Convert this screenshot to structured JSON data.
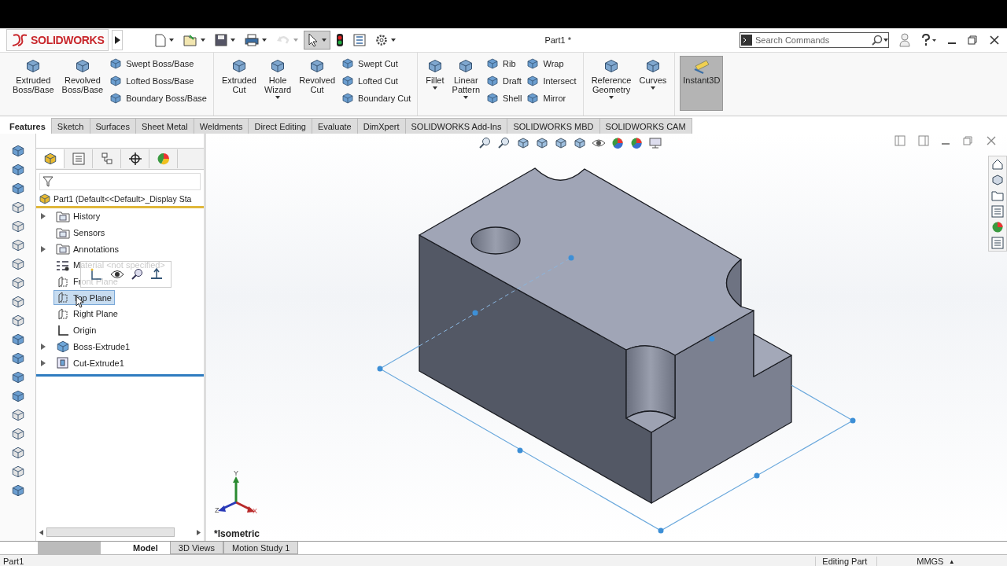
{
  "title_bar": {
    "logo": "SOLIDWORKS",
    "document_title": "Part1 *",
    "search": {
      "placeholder": "Search Commands"
    }
  },
  "quick_access": [
    {
      "kind": "new",
      "disabled": false,
      "selected": false
    },
    {
      "kind": "open",
      "disabled": false,
      "selected": false
    },
    {
      "kind": "save",
      "disabled": false,
      "selected": false
    },
    {
      "kind": "print",
      "disabled": false,
      "selected": false
    },
    {
      "kind": "undo",
      "disabled": true,
      "selected": false
    },
    {
      "kind": "select",
      "disabled": false,
      "selected": true
    },
    {
      "kind": "rebuild",
      "disabled": false,
      "selected": false
    },
    {
      "kind": "properties",
      "disabled": false,
      "selected": false
    },
    {
      "kind": "options",
      "disabled": false,
      "selected": false
    }
  ],
  "ribbon": {
    "groups": [
      {
        "items": [
          {
            "kind": "large",
            "label": "Extruded\nBoss/Base",
            "dropdown": false,
            "selected": false
          },
          {
            "kind": "large",
            "label": "Revolved\nBoss/Base",
            "dropdown": false,
            "selected": false
          },
          {
            "kind": "stack",
            "items": [
              {
                "label": "Swept Boss/Base"
              },
              {
                "label": "Lofted Boss/Base"
              },
              {
                "label": "Boundary Boss/Base"
              }
            ]
          }
        ]
      },
      {
        "items": [
          {
            "kind": "large",
            "label": "Extruded\nCut",
            "dropdown": false,
            "selected": false
          },
          {
            "kind": "large",
            "label": "Hole\nWizard",
            "dropdown": true,
            "selected": false
          },
          {
            "kind": "large",
            "label": "Revolved\nCut",
            "dropdown": false,
            "selected": false
          },
          {
            "kind": "stack",
            "items": [
              {
                "label": "Swept Cut"
              },
              {
                "label": "Lofted Cut"
              },
              {
                "label": "Boundary Cut"
              }
            ]
          }
        ]
      },
      {
        "items": [
          {
            "kind": "large",
            "label": "Fillet",
            "dropdown": true,
            "selected": false
          },
          {
            "kind": "large",
            "label": "Linear\nPattern",
            "dropdown": true,
            "selected": false
          },
          {
            "kind": "stack",
            "items": [
              {
                "label": "Rib"
              },
              {
                "label": "Draft"
              },
              {
                "label": "Shell"
              }
            ]
          },
          {
            "kind": "stack",
            "items": [
              {
                "label": "Wrap"
              },
              {
                "label": "Intersect"
              },
              {
                "label": "Mirror"
              }
            ]
          }
        ]
      },
      {
        "items": [
          {
            "kind": "large",
            "label": "Reference\nGeometry",
            "dropdown": true,
            "selected": false
          },
          {
            "kind": "large",
            "label": "Curves",
            "dropdown": true,
            "selected": false
          }
        ]
      },
      {
        "items": [
          {
            "kind": "large",
            "label": "Instant3D",
            "dropdown": false,
            "selected": true
          }
        ]
      }
    ]
  },
  "command_tabs": [
    {
      "label": "Features",
      "selected": true
    },
    {
      "label": "Sketch",
      "selected": false
    },
    {
      "label": "Surfaces",
      "selected": false
    },
    {
      "label": "Sheet Metal",
      "selected": false
    },
    {
      "label": "Weldments",
      "selected": false
    },
    {
      "label": "Direct Editing",
      "selected": false
    },
    {
      "label": "Evaluate",
      "selected": false
    },
    {
      "label": "DimXpert",
      "selected": false
    },
    {
      "label": "SOLIDWORKS Add-Ins",
      "selected": false
    },
    {
      "label": "SOLIDWORKS MBD",
      "selected": false
    },
    {
      "label": "SOLIDWORKS CAM",
      "selected": false
    }
  ],
  "left_toolbar": [
    {
      "disabled": false
    },
    {
      "disabled": false
    },
    {
      "disabled": false
    },
    {
      "disabled": true
    },
    {
      "disabled": true
    },
    {
      "disabled": true
    },
    {
      "disabled": true
    },
    {
      "disabled": true
    },
    {
      "disabled": true
    },
    {
      "disabled": true
    },
    {
      "disabled": false
    },
    {
      "disabled": false
    },
    {
      "disabled": false
    },
    {
      "disabled": false
    },
    {
      "disabled": true
    },
    {
      "disabled": true
    },
    {
      "disabled": true
    },
    {
      "disabled": true
    },
    {
      "disabled": false
    }
  ],
  "feature_tree": {
    "panel_tabs": [
      {
        "kind": "features",
        "selected": true
      },
      {
        "kind": "properties",
        "selected": false
      },
      {
        "kind": "configurations",
        "selected": false
      },
      {
        "kind": "dimxpert",
        "selected": false
      },
      {
        "kind": "display",
        "selected": false
      }
    ],
    "root": "Part1  (Default<<Default>_Display Sta",
    "items": [
      {
        "kind": "folder",
        "label": "History",
        "expander": true,
        "selected": false
      },
      {
        "kind": "folder",
        "label": "Sensors",
        "expander": false,
        "selected": false
      },
      {
        "kind": "folder",
        "label": "Annotations",
        "expander": true,
        "selected": false
      },
      {
        "kind": "material",
        "label": "Material <not specified>",
        "expander": false,
        "selected": false
      },
      {
        "kind": "plane",
        "label": "Front Plane",
        "expander": false,
        "selected": false
      },
      {
        "kind": "plane",
        "label": "Top Plane",
        "expander": false,
        "selected": true
      },
      {
        "kind": "plane",
        "label": "Right Plane",
        "expander": false,
        "selected": false
      },
      {
        "kind": "origin",
        "label": "Origin",
        "expander": false,
        "selected": false
      },
      {
        "kind": "boss",
        "label": "Boss-Extrude1",
        "expander": true,
        "selected": false
      },
      {
        "kind": "cut",
        "label": "Cut-Extrude1",
        "expander": true,
        "selected": false
      }
    ]
  },
  "viewport": {
    "view_name": "*Isometric",
    "triad": {
      "x": "X",
      "y": "Y",
      "z": "Z"
    }
  },
  "bottom_tabs": [
    {
      "label": "Model",
      "selected": true
    },
    {
      "label": "3D Views",
      "selected": false
    },
    {
      "label": "Motion Study 1",
      "selected": false
    }
  ],
  "status_bar": {
    "document": "Part1",
    "mode": "Editing Part",
    "units": "MMGS",
    "units_arrow": "▴"
  }
}
